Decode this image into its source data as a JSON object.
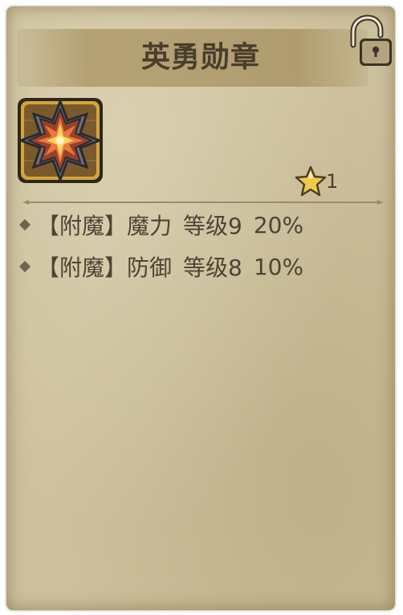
{
  "item": {
    "name": "英勇勋章",
    "star_count": "1"
  },
  "attributes": [
    {
      "tag": "【附魔】",
      "stat": "魔力",
      "level": "等级9",
      "value": "20%"
    },
    {
      "tag": "【附魔】",
      "stat": "防御",
      "level": "等级8",
      "value": "10%"
    }
  ],
  "icons": {
    "lock": "unlocked-padlock-icon",
    "item": "medal-star-icon",
    "star": "star-icon"
  },
  "colors": {
    "card_bg": "#cdc09c",
    "text": "#4e4434",
    "star_fill": "#f0c94a"
  }
}
